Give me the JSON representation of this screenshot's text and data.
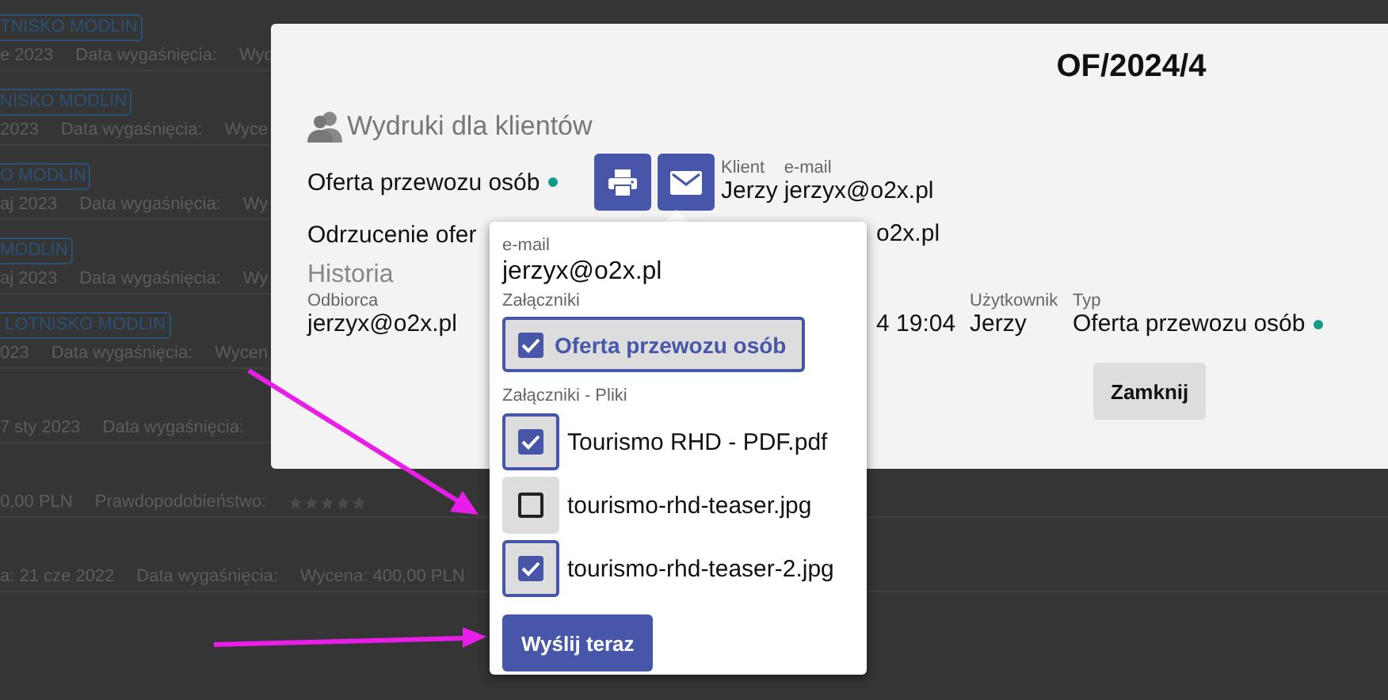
{
  "background_list": {
    "rows": [
      {
        "tag": "TNISKO MODLIN",
        "fields": [
          "e 2023",
          "Data wygaśnięcia:",
          "Wyc"
        ]
      },
      {
        "tag": "NISKO MODLIN",
        "fields": [
          "2023",
          "Data wygaśnięcia:",
          "Wyce"
        ]
      },
      {
        "tag": "O MODLIN",
        "fields": [
          "aj 2023",
          "Data wygaśnięcia:",
          "Wy"
        ]
      },
      {
        "tag": "MODLIN",
        "fields": [
          "aj 2023",
          "Data wygaśnięcia:",
          "Wy"
        ]
      },
      {
        "tag": " LOTNISKO MODLIN",
        "fields": [
          "023",
          "Data wygaśnięcia:",
          "Wycen"
        ]
      },
      {
        "fields": [
          "7 sty 2023",
          "Data wygaśnięcia:"
        ]
      },
      {
        "fields": [
          "0,00 PLN",
          "Prawdopodobieństwo:"
        ],
        "stars": 0
      },
      {
        "fields": [
          "a: 21 cze 2022",
          "Data wygaśnięcia:",
          "Wycena: 400,00 PLN"
        ]
      }
    ]
  },
  "modal": {
    "title": "OF/2024/4",
    "prints": {
      "heading": "Wydruki dla klientów",
      "documents": [
        {
          "name": "Oferta przewozu osób",
          "sent": true,
          "client_label": "Klient",
          "client": "Jerzy",
          "email_label": "e-mail",
          "email": "jerzyx@o2x.pl"
        },
        {
          "name": "Odrzucenie ofer",
          "email": "o2x.pl"
        }
      ]
    },
    "history": {
      "heading": "Historia",
      "columns": [
        {
          "label": "Odbiorca",
          "value": "jerzyx@o2x.pl"
        },
        {
          "value": "4 19:04"
        },
        {
          "label": "Użytkownik",
          "value": "Jerzy"
        },
        {
          "label": "Typ",
          "value": "Oferta przewozu osób",
          "sent": true
        }
      ]
    },
    "close_button": "Zamknij"
  },
  "popover": {
    "email_label": "e-mail",
    "email": "jerzyx@o2x.pl",
    "attachments_label": "Załączniki",
    "attachments": [
      {
        "label": "Oferta przewozu osób",
        "checked": true
      }
    ],
    "files_label": "Załączniki - Pliki",
    "files": [
      {
        "name": "Tourismo RHD - PDF.pdf",
        "checked": true
      },
      {
        "name": "tourismo-rhd-teaser.jpg",
        "checked": false
      },
      {
        "name": "tourismo-rhd-teaser-2.jpg",
        "checked": true
      }
    ],
    "send_button": "Wyślij teraz"
  }
}
